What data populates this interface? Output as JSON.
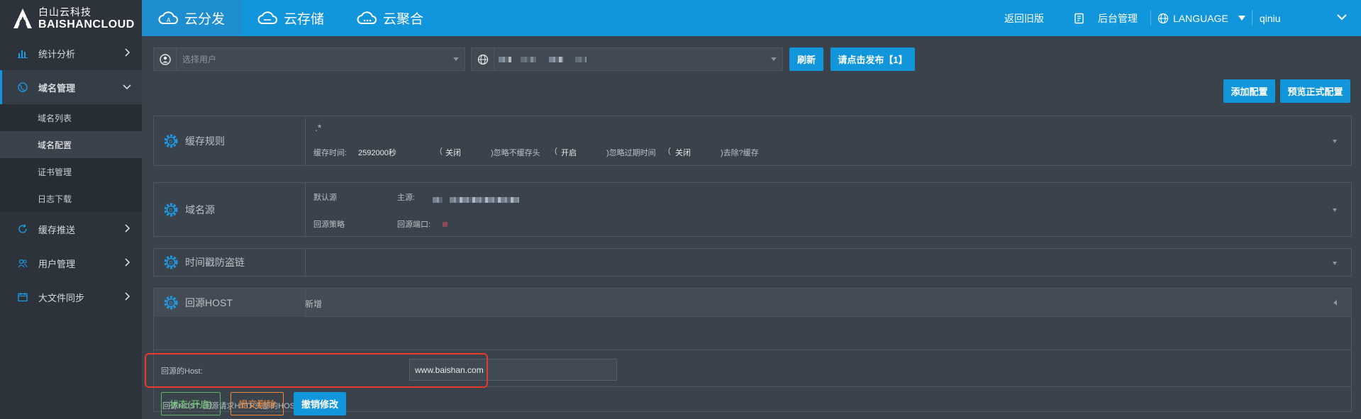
{
  "brand": {
    "cn": "白山云科技",
    "en": "BAISHANCLOUD"
  },
  "nav": {
    "tabs": [
      {
        "label": "云分发",
        "active": true
      },
      {
        "label": "云存储",
        "active": false
      },
      {
        "label": "云聚合",
        "active": false
      }
    ],
    "back_old": "返回旧版",
    "admin": "后台管理",
    "language": "LANGUAGE",
    "user": "qiniu"
  },
  "sidebar": {
    "items": [
      {
        "label": "统计分析",
        "icon": "bar-chart-icon"
      },
      {
        "label": "域名管理",
        "icon": "globe-icon",
        "active": true
      },
      {
        "label": "缓存推送",
        "icon": "refresh-icon"
      },
      {
        "label": "用户管理",
        "icon": "users-icon"
      },
      {
        "label": "大文件同步",
        "icon": "calendar-icon"
      }
    ],
    "sub_items": [
      {
        "label": "域名列表"
      },
      {
        "label": "域名配置",
        "active": true
      },
      {
        "label": "证书管理"
      },
      {
        "label": "日志下载"
      }
    ]
  },
  "toolbar": {
    "user_placeholder": "选择用户",
    "refresh": "刷新",
    "publish": "请点击发布【1】",
    "add_config": "添加配置",
    "preview_config": "预览正式配置"
  },
  "cache_rule": {
    "title": "缓存规则",
    "pattern": ".*",
    "cache_time_label": "缓存时间:",
    "cache_time_value": "2592000秒",
    "paren1_open": "(",
    "off1": "关闭",
    "ignore_no_cache": ")忽略不缓存头",
    "paren2_open": "(",
    "on": "开启",
    "ignore_expire": ")忽略过期时间",
    "paren3_open": "(",
    "off2": "关闭",
    "strip_cache": ")去除?缓存"
  },
  "origin": {
    "title": "域名源",
    "default_source": "默认源",
    "primary_label": "主源:",
    "back_strategy": "回源策略",
    "back_port_label": "回源端口:"
  },
  "timestamp": {
    "title": "时间戳防盗链"
  },
  "host": {
    "title": "回源HOST",
    "add_new": "新增",
    "host_label": "回源的Host:",
    "host_value": "www.baishan.com",
    "status_btn": "状态(开启)",
    "delete_btn": "提交删除",
    "undo_btn": "撤销修改",
    "note": "回源HOST: 回源请求HTTP头部的HOST字段"
  },
  "colors": {
    "accent": "#1296db",
    "highlight": "#e8392b",
    "status_green": "#5cb85c",
    "delete_orange": "#f0883a"
  }
}
